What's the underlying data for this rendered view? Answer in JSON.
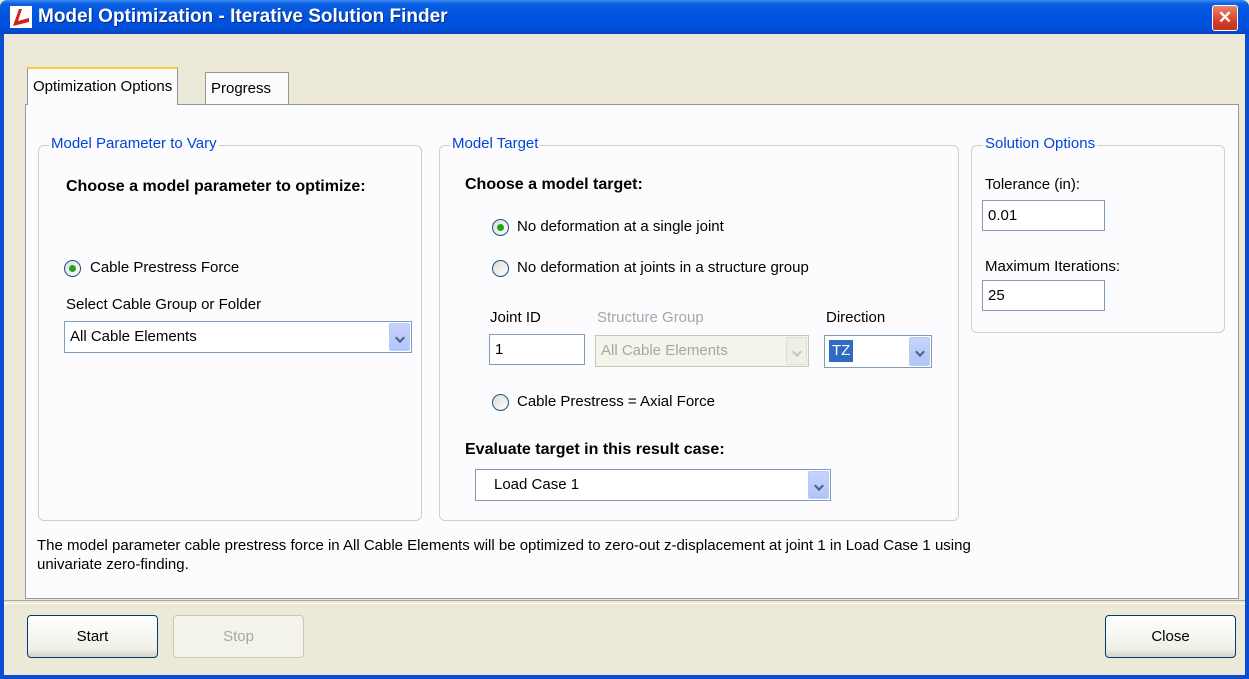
{
  "window": {
    "title": "Model Optimization - Iterative Solution Finder",
    "close_glyph": "✕"
  },
  "tabs": [
    {
      "label": "Optimization Options",
      "active": true
    },
    {
      "label": "Progress",
      "active": false
    }
  ],
  "parameter_group": {
    "title": "Model Parameter to Vary",
    "heading": "Choose a model parameter to optimize:",
    "radio_cable_prestress": {
      "label": "Cable Prestress Force",
      "checked": true
    },
    "select_label": "Select Cable Group or Folder",
    "select_value": "All Cable Elements"
  },
  "target_group": {
    "title": "Model Target",
    "heading": "Choose a model target:",
    "radio_single_joint": {
      "label": "No deformation at a single joint",
      "checked": true
    },
    "radio_structure_group": {
      "label": "No deformation at joints in a structure group",
      "checked": false
    },
    "joint_id_label": "Joint ID",
    "joint_id_value": "1",
    "structure_group_label": "Structure Group",
    "structure_group_value": "All Cable Elements",
    "direction_label": "Direction",
    "direction_value": "TZ",
    "radio_axial_force": {
      "label": "Cable Prestress = Axial Force",
      "checked": false
    },
    "result_case_heading": "Evaluate target in this result case:",
    "result_case_value": "Load Case 1"
  },
  "solution_group": {
    "title": "Solution Options",
    "tolerance_label": "Tolerance (in):",
    "tolerance_value": "0.01",
    "max_iter_label": "Maximum Iterations:",
    "max_iter_value": "25"
  },
  "summary_text": "The model parameter cable prestress force in All Cable Elements will be optimized to zero-out z-displacement at joint 1 in Load Case 1 using univariate zero-finding.",
  "buttons": {
    "start": "Start",
    "stop": "Stop",
    "close": "Close"
  },
  "colors": {
    "titlebar": "#0053e0",
    "group_title": "#0046d5",
    "dialog_bg": "#ece9d8",
    "radio_checked": "#21a121"
  }
}
